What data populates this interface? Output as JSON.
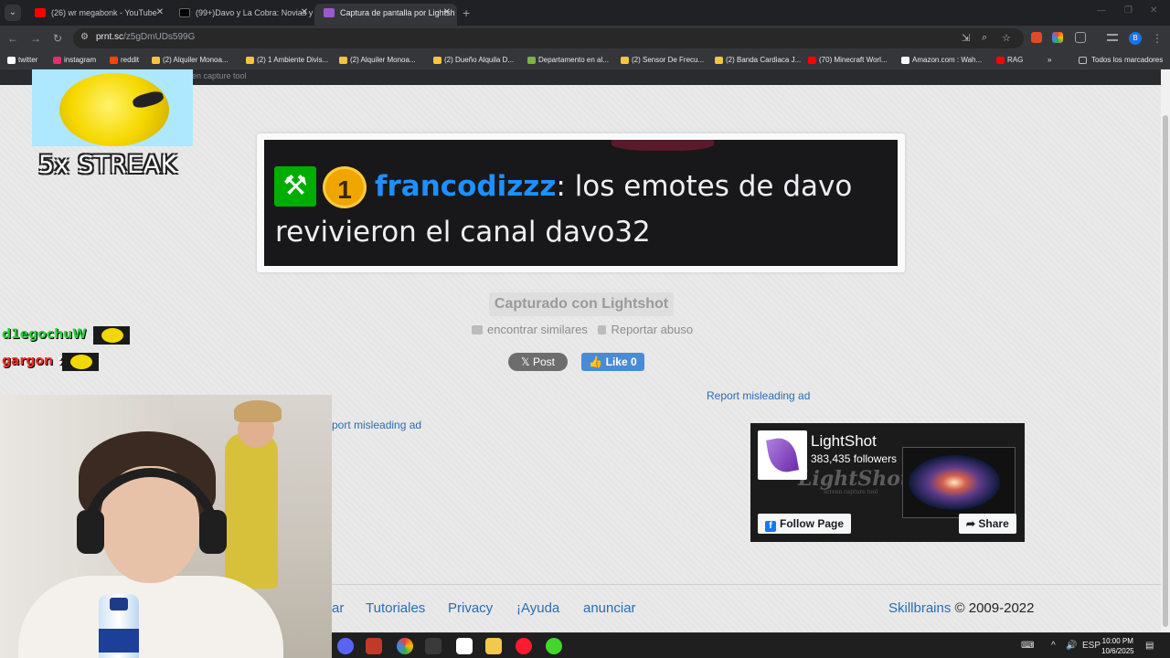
{
  "browser": {
    "tabs": [
      {
        "label": "(26) wr megabonk - YouTube",
        "favicon_color": "#ff0000",
        "active": false
      },
      {
        "label": "(99+)Davo y La Cobra: Novias y",
        "favicon_color": "#000000",
        "active": false
      },
      {
        "label": "Captura de pantalla por Lightsh",
        "favicon_color": "#9b59d0",
        "active": true
      }
    ],
    "new_tab": "+",
    "url_host": "prnt.sc",
    "url_path": "/z5gDmUDs599G",
    "bookmarks": [
      {
        "label": "twitter",
        "color": "#ffffff"
      },
      {
        "label": "instagram",
        "color": "#e1306c"
      },
      {
        "label": "reddit",
        "color": "#ff4500"
      },
      {
        "label": "(2) Alquiler Monoa...",
        "color": "#f5c542"
      },
      {
        "label": "(2) 1 Ambiente Divis...",
        "color": "#f5c542"
      },
      {
        "label": "(2) Alquiler Monoa...",
        "color": "#f5c542"
      },
      {
        "label": "(2) Dueño Alquila D...",
        "color": "#f5c542"
      },
      {
        "label": "Departamento en al...",
        "color": "#7cb342"
      },
      {
        "label": "(2) Sensor De Frecu...",
        "color": "#f5c542"
      },
      {
        "label": "(2) Banda Cardiaca J...",
        "color": "#f5c542"
      },
      {
        "label": "(70) Minecraft Worl...",
        "color": "#ff0000"
      },
      {
        "label": "Amazon.com : Wah...",
        "color": "#ffffff"
      },
      {
        "label": "RAG",
        "color": "#ff0000"
      }
    ],
    "bookmarks_overflow": "»",
    "all_bookmarks": "Todos los marcadores",
    "profile_initial": "B"
  },
  "page": {
    "top_strip_text": "en capture tool",
    "screenshot": {
      "mod_badge_icon": "gavel-icon",
      "sub_badge": "1",
      "username": "francodizzz",
      "message_part1": ": los emotes de davo",
      "message_part2": "revivieron el canal davo32"
    },
    "captured_with": "Capturado con Lightshot",
    "find_similar": "encontrar similares",
    "report_abuse": "Reportar abuso",
    "x_post": "𝕏 Post",
    "fb_like": "👍 Like 0",
    "report_misleading_ad": "Report misleading ad",
    "report_misleading_ad_left": "port misleading ad",
    "fb_widget": {
      "page_name": "LightShot",
      "followers": "383,435 followers",
      "watermark": "LightShot",
      "watermark_sub": "screen capture tool",
      "follow_page": "Follow Page",
      "share": "Share"
    },
    "footer": {
      "links": [
        "ar",
        "Tutoriales",
        "Privacy",
        "¡Ayuda",
        "anunciar"
      ],
      "company": "Skillbrains",
      "copyright": "© 2009-2022"
    }
  },
  "stream_overlay": {
    "streak_text": "5x STREAK",
    "chat": [
      {
        "user": "d1egochuW",
        "color": "#2ecc40"
      },
      {
        "user": "gargon",
        "color": "#e0312a"
      }
    ]
  },
  "taskbar": {
    "language": "ESP",
    "time": "10:00 PM",
    "date": "10/6/2025"
  }
}
